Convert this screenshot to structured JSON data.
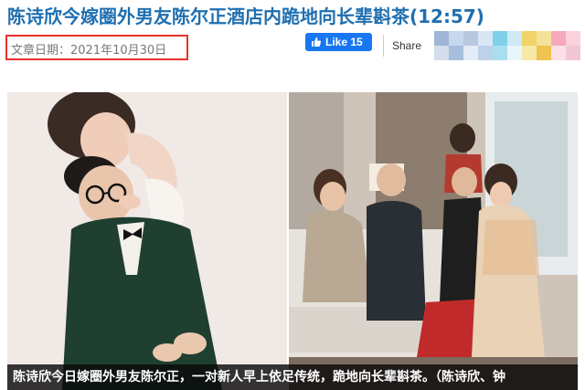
{
  "article": {
    "title": "陈诗欣今嫁圈外男友陈尔正酒店内跪地向长辈斟茶(12:57)",
    "date": "文章日期：2021年10月30日"
  },
  "social": {
    "like_label": "Like 15",
    "share_label": "Share",
    "like_color": "#1877f2"
  },
  "photos": {
    "caption": "陈诗欣今日嫁圈外男友陈尔正，一对新人早上依足传统，跪地向长辈斟茶。（陈诗欣、钟"
  },
  "colors": {
    "title": "#1f6fb0",
    "date_highlight": "#e8322b"
  }
}
